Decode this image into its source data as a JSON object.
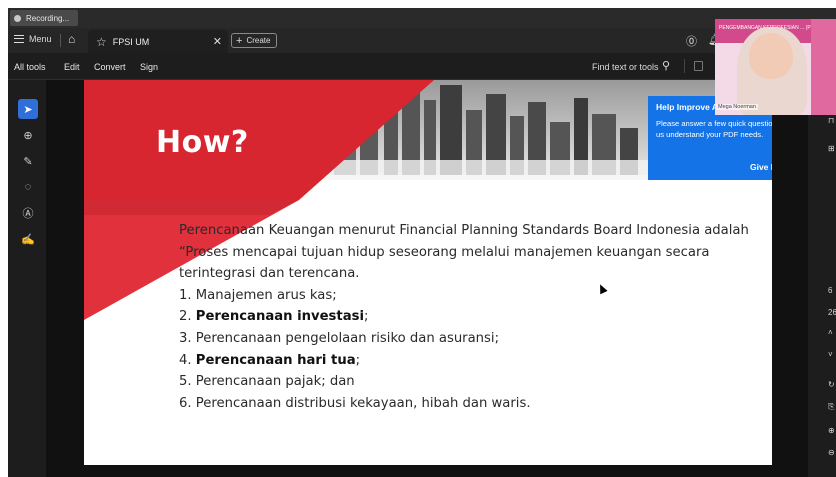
{
  "recording": {
    "label": "Recording..."
  },
  "titlebar": {
    "menu_label": "Menu",
    "tab_title": "FPSI UM",
    "create_label": "Create"
  },
  "toolbar": {
    "items": [
      "All tools",
      "Edit",
      "Convert",
      "Sign"
    ],
    "find_label": "Find text or tools"
  },
  "page": {
    "heading": "How?",
    "intro": "Perencanaan Keuangan menurut Financial Planning Standards Board Indonesia adalah “Proses mencapai tujuan hidup seseorang melalui manajemen keuangan secara terintegrasi dan terencana.",
    "list": [
      {
        "prefix": "1. ",
        "text": "Manajemen arus kas",
        "suffix": ";",
        "bold": false
      },
      {
        "prefix": "2. ",
        "text": "Perencanaan investasi",
        "suffix": ";",
        "bold": true
      },
      {
        "prefix": "3. ",
        "text": "Perencanaan pengelolaan risiko dan asuransi",
        "suffix": ";",
        "bold": false
      },
      {
        "prefix": "4. ",
        "text": "Perencanaan hari tua",
        "suffix": ";",
        "bold": true
      },
      {
        "prefix": "5. ",
        "text": "Perencanaan pajak",
        "suffix": "; dan",
        "bold": false
      },
      {
        "prefix": "6. ",
        "text": "Perencanaan distribusi kekayaan, hibah dan waris",
        "suffix": ".",
        "bold": false
      }
    ]
  },
  "help_popup": {
    "title": "Help Improve Acrobat F",
    "body": "Please answer a few quick questions to help us understand your PDF needs.",
    "button": "Give Feedback"
  },
  "right_panel": {
    "page_num": "6",
    "page_total": "26"
  },
  "webcam": {
    "name": "Mega Noerman",
    "banner": "PENGEMBANGAN KEPROFESIAN ... (PPKB)"
  },
  "colors": {
    "accent_blue": "#1473e6",
    "slide_red": "#d7262f",
    "selected_tool": "#2f6fd7"
  }
}
